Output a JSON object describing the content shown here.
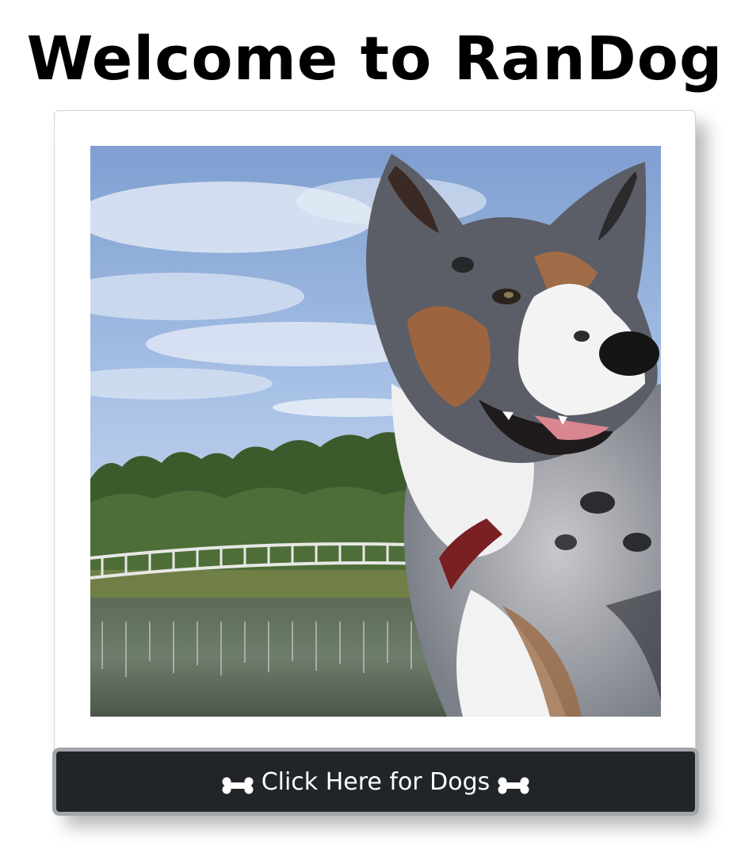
{
  "page": {
    "title": "Welcome to RanDog"
  },
  "dog_card": {
    "image_alt": "Australian Shepherd dog by a pond with a white bridge",
    "button_label": "Click Here for Dogs",
    "button_left_icon": "bone-icon",
    "button_right_icon": "bone-icon"
  },
  "colors": {
    "button_bg": "#212529",
    "button_border": "#a2a6ab",
    "title_text": "#000000"
  }
}
